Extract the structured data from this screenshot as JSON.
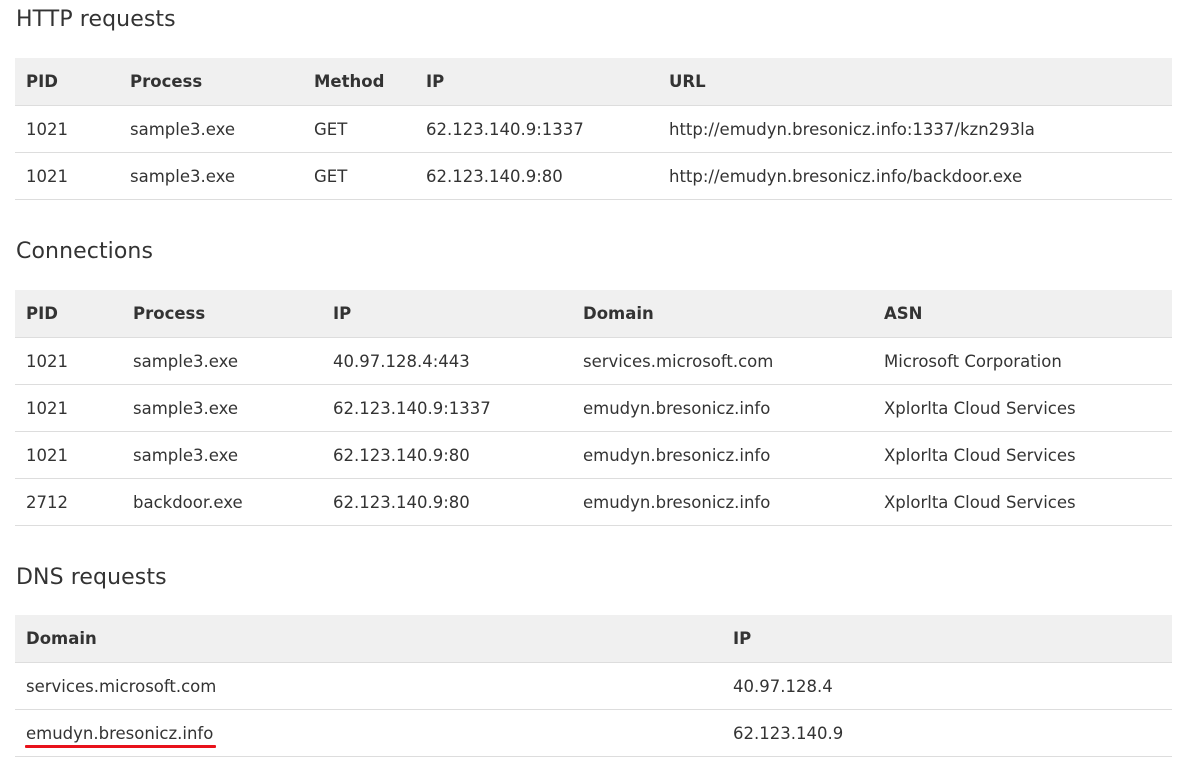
{
  "http": {
    "title": "HTTP requests",
    "headers": [
      "PID",
      "Process",
      "Method",
      "IP",
      "URL"
    ],
    "rows": [
      [
        "1021",
        "sample3.exe",
        "GET",
        "62.123.140.9:1337",
        "http://emudyn.bresonicz.info:1337/kzn293la"
      ],
      [
        "1021",
        "sample3.exe",
        "GET",
        "62.123.140.9:80",
        "http://emudyn.bresonicz.info/backdoor.exe"
      ]
    ]
  },
  "connections": {
    "title": "Connections",
    "headers": [
      "PID",
      "Process",
      "IP",
      "Domain",
      "ASN"
    ],
    "rows": [
      [
        "1021",
        "sample3.exe",
        "40.97.128.4:443",
        "services.microsoft.com",
        "Microsoft Corporation"
      ],
      [
        "1021",
        "sample3.exe",
        "62.123.140.9:1337",
        "emudyn.bresonicz.info",
        "Xplorlta Cloud Services"
      ],
      [
        "1021",
        "sample3.exe",
        "62.123.140.9:80",
        "emudyn.bresonicz.info",
        "Xplorlta Cloud Services"
      ],
      [
        "2712",
        "backdoor.exe",
        "62.123.140.9:80",
        "emudyn.bresonicz.info",
        "Xplorlta Cloud Services"
      ]
    ]
  },
  "dns": {
    "title": "DNS requests",
    "headers": [
      "Domain",
      "IP"
    ],
    "rows": [
      [
        "services.microsoft.com",
        "40.97.128.4"
      ],
      [
        "emudyn.bresonicz.info",
        "62.123.140.9"
      ]
    ]
  },
  "highlight_color": "#e8121b"
}
